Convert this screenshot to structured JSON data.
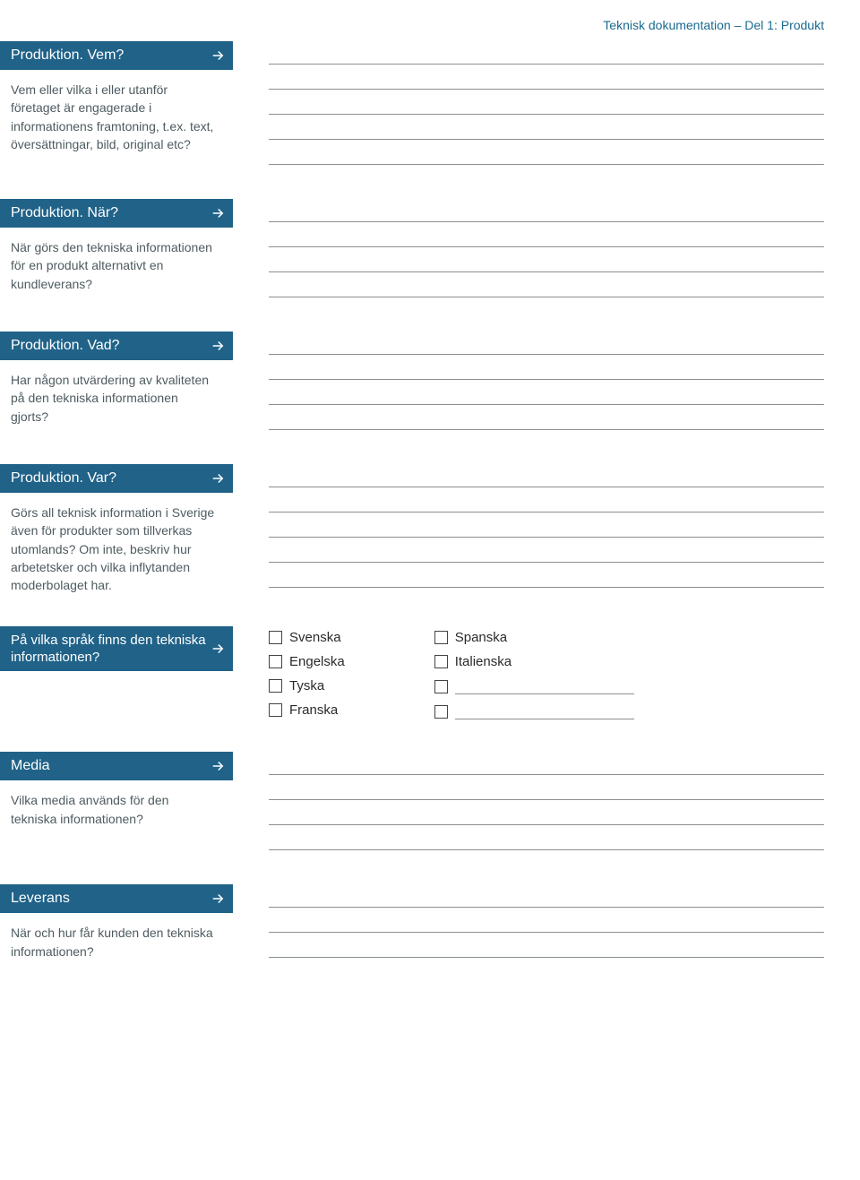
{
  "breadcrumb": "Teknisk dokumentation – Del 1: Produkt",
  "sections": {
    "vem": {
      "title": "Produktion. Vem?",
      "desc": "Vem eller vilka i eller utanför företaget är engagerade i informationens framtoning, t.ex. text, översättningar, bild, original etc?"
    },
    "nar": {
      "title": "Produktion. När?",
      "desc": "När görs den tekniska informationen för en produkt alternativt en kundleverans?"
    },
    "vad": {
      "title": "Produktion. Vad?",
      "desc": "Har någon utvärdering av kvaliteten på den tekniska informationen gjorts?"
    },
    "var": {
      "title": "Produktion. Var?",
      "desc": "Görs all teknisk information i Sverige även för produkter som tillverkas utomlands? Om inte, beskriv hur arbetetsker och vilka inflytanden moderbolaget har."
    },
    "sprak": {
      "title": "På vilka språk finns den tekniska informationen?",
      "options_left": [
        "Svenska",
        "Engelska",
        "Tyska",
        "Franska"
      ],
      "options_right": [
        "Spanska",
        "Italienska"
      ]
    },
    "media": {
      "title": "Media",
      "desc": "Vilka media används för den tekniska informationen?"
    },
    "leverans": {
      "title": "Leverans",
      "desc": "När och hur får kunden den tekniska informationen?"
    }
  }
}
